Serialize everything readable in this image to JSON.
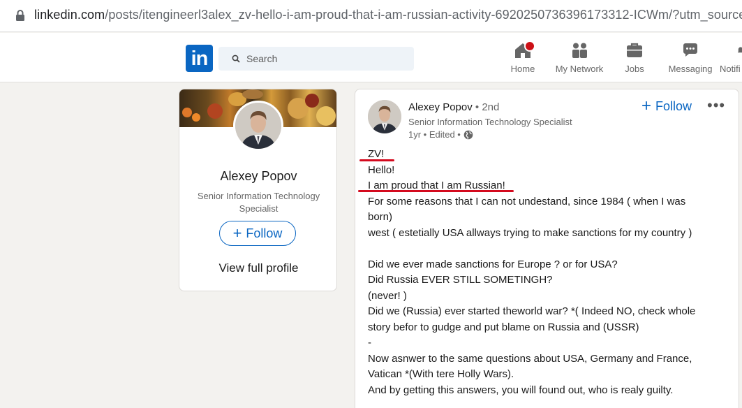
{
  "browser": {
    "url_host": "linkedin.com",
    "url_path": "/posts/itengineerl3alex_zv-hello-i-am-proud-that-i-am-russian-activity-6920250736396173312-ICWm/?utm_source=sh"
  },
  "nav": {
    "logo": "in",
    "search_placeholder": "Search",
    "items": [
      {
        "label": "Home",
        "icon": "home-icon"
      },
      {
        "label": "My Network",
        "icon": "network-icon"
      },
      {
        "label": "Jobs",
        "icon": "briefcase-icon"
      },
      {
        "label": "Messaging",
        "icon": "chat-icon"
      },
      {
        "label": "Notifi",
        "icon": "bell-icon"
      }
    ]
  },
  "profile_card": {
    "name": "Alexey Popov",
    "title": "Senior Information Technology Specialist",
    "follow_label": "Follow",
    "view_profile": "View full profile"
  },
  "post": {
    "author": "Alexey Popov",
    "degree": "• 2nd",
    "subtitle": "Senior Information Technology Specialist",
    "meta": "1yr • Edited •",
    "follow_label": "Follow",
    "more": "•••",
    "lines": [
      "ZV!",
      "Hello!",
      "I am proud that I am Russian!",
      "For some reasons that I can not undestand, since 1984 ( when I was",
      "born)",
      "west ( estetially USA allways trying to make sanctions for my country )",
      "",
      "Did we ever made sanctions for Europe ? or for USA?",
      "Did Russia EVER STILL SOMETINGH?",
      "(never! )",
      "Did we (Russia) ever started theworld war? *( Indeed NO, check whole",
      "story befor to gudge and put blame on Russia and (USSR)",
      "-",
      "Now asnwer to the same questions about USA, Germany and France,",
      "Vatican *(With tere Holly Wars).",
      "And by getting this answers, you will found out, who is realy guilty."
    ]
  },
  "colors": {
    "linkedin_blue": "#0a66c2",
    "annotation_red": "#d40a1e",
    "notification_red": "#cc1016"
  }
}
